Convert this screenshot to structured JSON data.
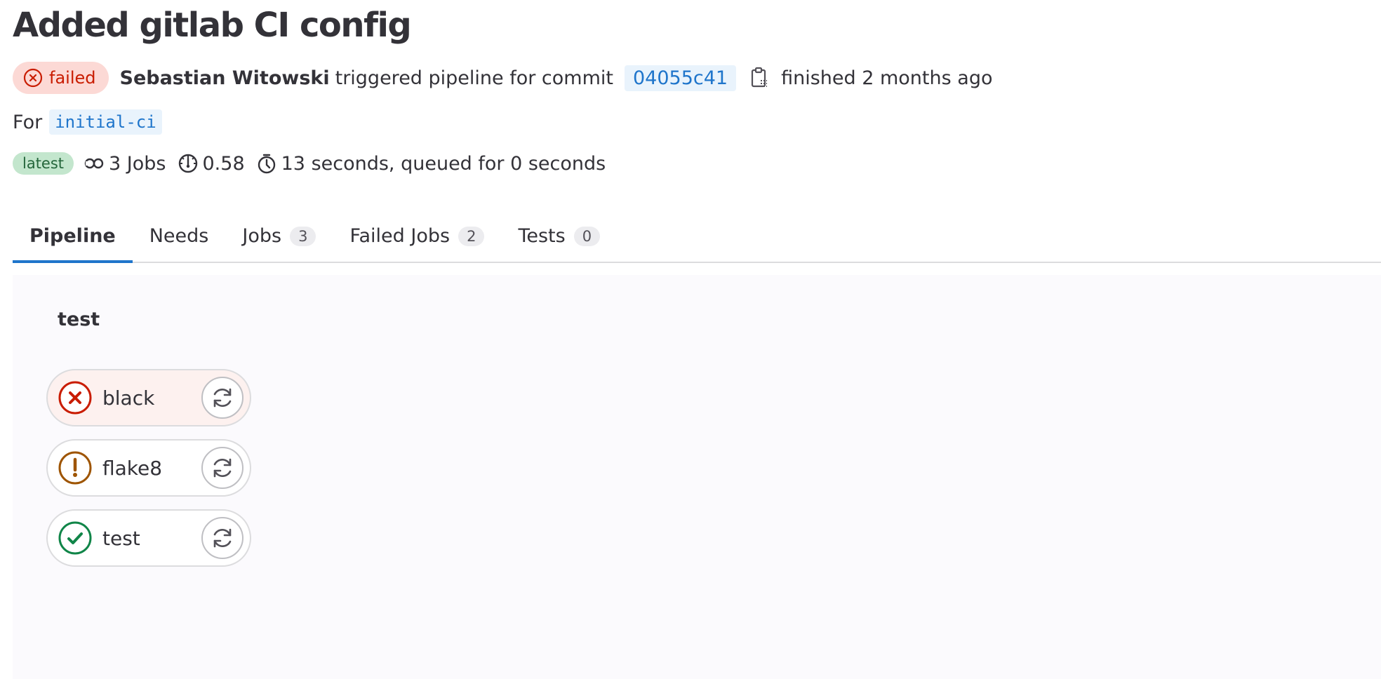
{
  "page_title": "Added gitlab CI config",
  "header": {
    "status": "failed",
    "author": "Sebastian Witowski",
    "action_text": "triggered pipeline for commit",
    "commit_sha": "04055c41",
    "finished_text": "finished 2 months ago",
    "for_label": "For",
    "ref": "initial-ci"
  },
  "meta": {
    "latest_badge": "latest",
    "jobs_text": "3 Jobs",
    "compute_text": "0.58",
    "duration_text": "13 seconds, queued for 0 seconds"
  },
  "tabs": [
    {
      "label": "Pipeline",
      "count": null,
      "active": true
    },
    {
      "label": "Needs",
      "count": null,
      "active": false
    },
    {
      "label": "Jobs",
      "count": "3",
      "active": false
    },
    {
      "label": "Failed Jobs",
      "count": "2",
      "active": false
    },
    {
      "label": "Tests",
      "count": "0",
      "active": false
    }
  ],
  "stage": {
    "title": "test",
    "jobs": [
      {
        "name": "black",
        "status": "failed",
        "status_icon": "status-failed-icon",
        "action_icon": "retry-icon"
      },
      {
        "name": "flake8",
        "status": "warning",
        "status_icon": "status-warning-icon",
        "action_icon": "retry-icon"
      },
      {
        "name": "test",
        "status": "success",
        "status_icon": "status-success-icon",
        "action_icon": "retry-icon"
      }
    ]
  },
  "colors": {
    "failed": "#c91c00",
    "warning": "#9e5400",
    "success": "#108548",
    "link": "#1f75cb",
    "tab_active": "#1f75cb"
  }
}
